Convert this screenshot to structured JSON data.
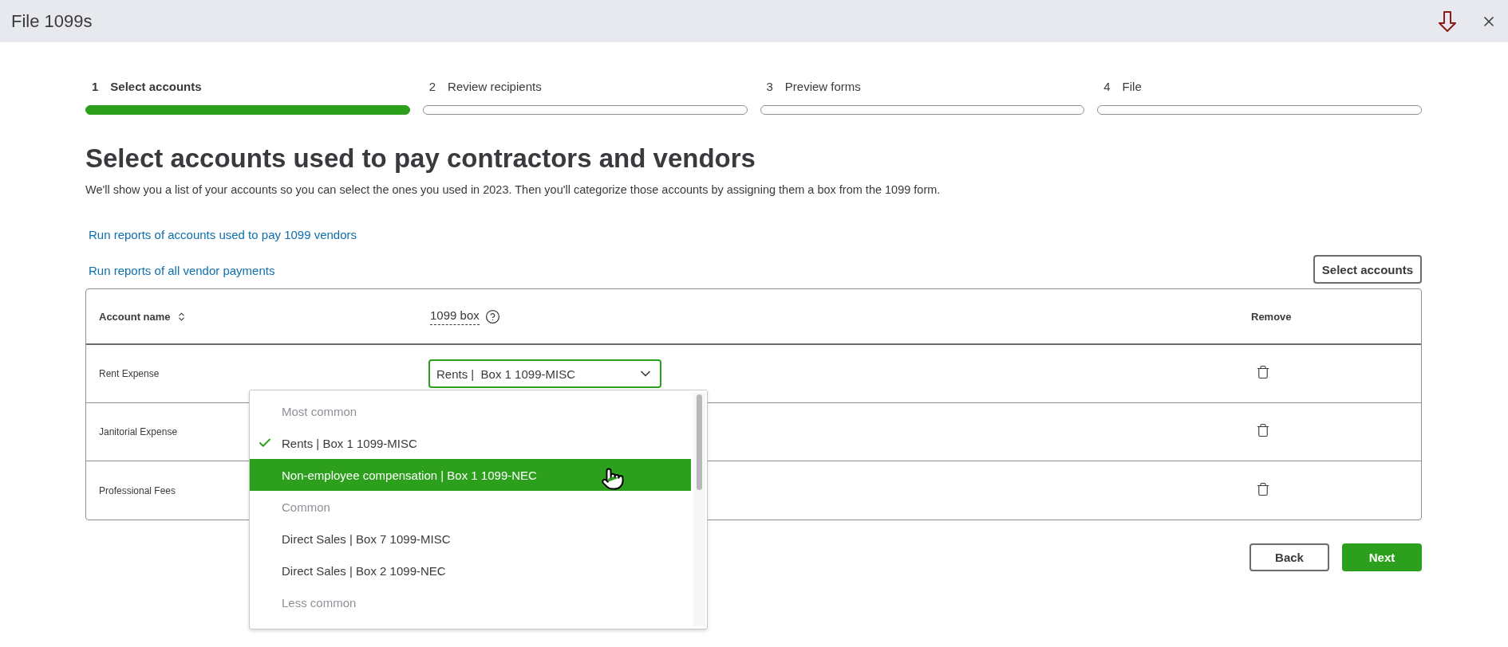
{
  "window": {
    "title": "File 1099s"
  },
  "steps": [
    {
      "number": "1",
      "label": "Select accounts",
      "selected": true
    },
    {
      "number": "2",
      "label": "Review recipients",
      "selected": false
    },
    {
      "number": "3",
      "label": "Preview forms",
      "selected": false
    },
    {
      "number": "4",
      "label": "File",
      "selected": false
    }
  ],
  "heading": "Select accounts used to pay contractors and vendors",
  "description": "We'll show you a list of your accounts so you can select the ones you used in 2023. Then you'll categorize those accounts by assigning them a box from the 1099 form.",
  "links": [
    "Run reports of accounts used to pay 1099 vendors",
    "Run reports of all vendor payments"
  ],
  "select_accounts_button": "Select accounts",
  "table": {
    "columns": [
      {
        "label": "Account name",
        "sortable": true,
        "help": false
      },
      {
        "label": "1099 box",
        "sortable": false,
        "help": true
      },
      {
        "label": "Remove",
        "sortable": false,
        "help": false
      }
    ],
    "rows": [
      {
        "account": "Rent Expense",
        "box": "Rents |  Box 1 1099-MISC"
      },
      {
        "account": "Janitorial Expense"
      },
      {
        "account": "Professional Fees"
      }
    ]
  },
  "dropdown": {
    "items": [
      {
        "kind": "header",
        "label": "Most common"
      },
      {
        "kind": "option",
        "label": "Rents | Box 1 1099-MISC",
        "checked": true,
        "highlighted": false
      },
      {
        "kind": "option",
        "label": "Non-employee compensation | Box 1 1099-NEC",
        "checked": false,
        "highlighted": true
      },
      {
        "kind": "header",
        "label": "Common"
      },
      {
        "kind": "option",
        "label": "Direct Sales | Box 7 1099-MISC",
        "checked": false,
        "highlighted": false
      },
      {
        "kind": "option",
        "label": "Direct Sales | Box 2 1099-NEC",
        "checked": false,
        "highlighted": false
      },
      {
        "kind": "header",
        "label": "Less common"
      }
    ]
  },
  "footer_buttons": [
    {
      "label": "Back",
      "kind": "secondary"
    },
    {
      "label": "Next",
      "kind": "primary"
    }
  ]
}
